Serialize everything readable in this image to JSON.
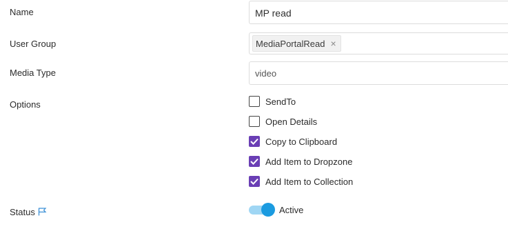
{
  "form": {
    "name": {
      "label": "Name",
      "value": "MP read"
    },
    "user_group": {
      "label": "User Group",
      "tags": [
        "MediaPortalRead"
      ]
    },
    "media_type": {
      "label": "Media Type",
      "value": "video"
    },
    "options": {
      "label": "Options",
      "items": [
        {
          "label": "SendTo",
          "checked": false
        },
        {
          "label": "Open Details",
          "checked": false
        },
        {
          "label": "Copy to Clipboard",
          "checked": true
        },
        {
          "label": "Add Item to Dropzone",
          "checked": true
        },
        {
          "label": "Add Item to Collection",
          "checked": true
        }
      ]
    },
    "status": {
      "label": "Status",
      "value": "Active",
      "enabled": true
    }
  },
  "colors": {
    "checkbox_checked": "#6a3fb5",
    "toggle_track": "#9fd6f4",
    "toggle_knob": "#1b9be0",
    "flag_icon": "#3a8fd6"
  },
  "icons": {
    "tag_remove": "×",
    "status_flag": "flag-icon"
  }
}
